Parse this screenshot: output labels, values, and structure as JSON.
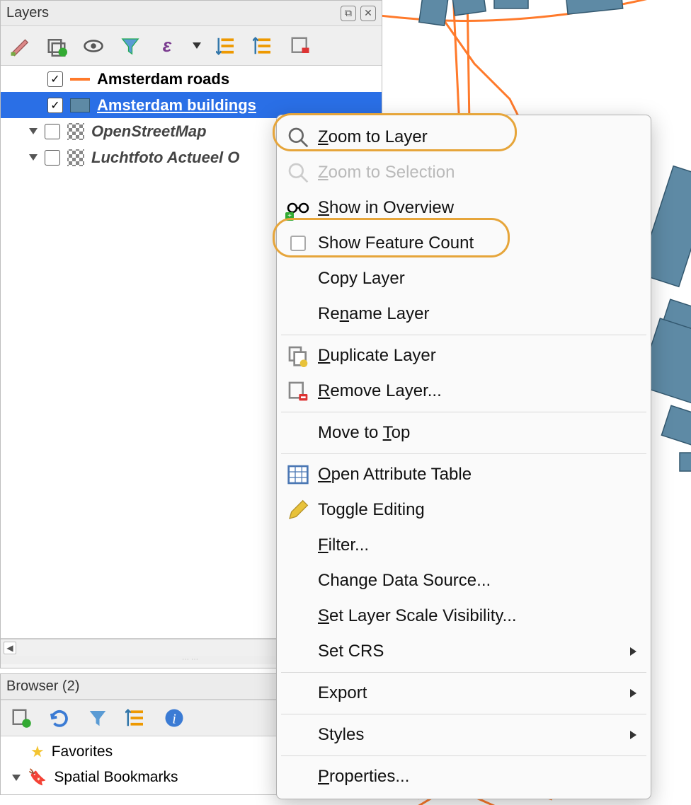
{
  "layers_panel": {
    "title": "Layers",
    "toolbar_icons": [
      "style-icon",
      "add-group-icon",
      "visibility-icon",
      "filter-icon",
      "expression-icon",
      "dropdown-icon",
      "expand-all-icon",
      "collapse-all-icon",
      "remove-layer-icon"
    ],
    "layers": [
      {
        "name": "Amsterdam roads",
        "checked": true,
        "selected": false,
        "style": "line",
        "expandable": false,
        "italic": false
      },
      {
        "name": "Amsterdam buildings",
        "checked": true,
        "selected": true,
        "style": "poly",
        "expandable": false,
        "italic": false
      },
      {
        "name": "OpenStreetMap",
        "checked": false,
        "selected": false,
        "style": "raster",
        "expandable": true,
        "italic": true
      },
      {
        "name": "Luchtfoto Actueel O",
        "checked": false,
        "selected": false,
        "style": "raster",
        "expandable": true,
        "italic": true
      }
    ]
  },
  "context_menu": {
    "items": [
      {
        "icon": "zoom-icon",
        "label_pre": "",
        "ul": "Z",
        "label_post": "oom to Layer",
        "enabled": true,
        "highlighted": true
      },
      {
        "icon": "zoom-icon",
        "label_pre": "",
        "ul": "Z",
        "label_post": "oom to Selection",
        "enabled": false
      },
      {
        "icon": "glasses-icon",
        "label_pre": "",
        "ul": "S",
        "label_post": "how in Overview",
        "enabled": true
      },
      {
        "icon": "checkbox",
        "label_pre": "Show Feature ",
        "ul": "",
        "label_post": "Count",
        "enabled": true,
        "highlighted": true
      },
      {
        "icon": "",
        "label_pre": "Copy Layer",
        "ul": "",
        "label_post": "",
        "enabled": true
      },
      {
        "icon": "",
        "label_pre": "Re",
        "ul": "n",
        "label_post": "ame Layer",
        "enabled": true
      },
      {
        "sep": true
      },
      {
        "icon": "duplicate-icon",
        "label_pre": "",
        "ul": "D",
        "label_post": "uplicate Layer",
        "enabled": true
      },
      {
        "icon": "remove-icon",
        "label_pre": "",
        "ul": "R",
        "label_post": "emove Layer...",
        "enabled": true
      },
      {
        "sep": true
      },
      {
        "icon": "",
        "label_pre": "Move to ",
        "ul": "T",
        "label_post": "op",
        "enabled": true
      },
      {
        "sep": true
      },
      {
        "icon": "table-icon",
        "label_pre": "",
        "ul": "O",
        "label_post": "pen Attribute Table",
        "enabled": true
      },
      {
        "icon": "pencil-icon",
        "label_pre": "Toggle Editing",
        "ul": "",
        "label_post": "",
        "enabled": true
      },
      {
        "icon": "",
        "label_pre": "",
        "ul": "F",
        "label_post": "ilter...",
        "enabled": true
      },
      {
        "icon": "",
        "label_pre": "Change Data Source...",
        "ul": "",
        "label_post": "",
        "enabled": true
      },
      {
        "icon": "",
        "label_pre": "",
        "ul": "S",
        "label_post": "et Layer Scale Visibility...",
        "enabled": true
      },
      {
        "icon": "",
        "label_pre": "Set CRS",
        "ul": "",
        "label_post": "",
        "enabled": true,
        "submenu": true
      },
      {
        "sep": true
      },
      {
        "icon": "",
        "label_pre": "Export",
        "ul": "",
        "label_post": "",
        "enabled": true,
        "submenu": true
      },
      {
        "sep": true
      },
      {
        "icon": "",
        "label_pre": "Styles",
        "ul": "",
        "label_post": "",
        "enabled": true,
        "submenu": true
      },
      {
        "sep": true
      },
      {
        "icon": "",
        "label_pre": "",
        "ul": "P",
        "label_post": "roperties...",
        "enabled": true
      }
    ]
  },
  "browser_panel": {
    "title": "Browser (2)",
    "toolbar_icons": [
      "add-layer-icon",
      "refresh-icon",
      "filter-icon",
      "collapse-icon",
      "info-icon"
    ],
    "items": [
      {
        "icon": "star",
        "label": "Favorites",
        "expandable": false
      },
      {
        "icon": "bookmark",
        "label": "Spatial Bookmarks",
        "expandable": true
      }
    ]
  },
  "colors": {
    "road": "#ff7a2b",
    "building_fill": "#5e8aa5",
    "building_stroke": "#33586f",
    "selection": "#2a6fe6",
    "highlight": "#e6a53a"
  }
}
